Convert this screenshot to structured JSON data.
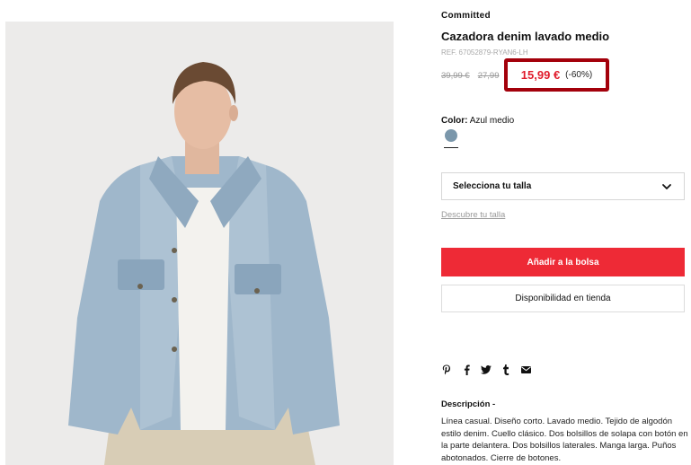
{
  "product": {
    "brand": "Committed",
    "title": "Cazadora denim lavado medio",
    "ref": "REF. 67052879-RYAN6-LH",
    "old_price_1": "39,99 €",
    "old_price_2": "27,99",
    "price": "15,99 €",
    "discount": "(-60%)"
  },
  "color": {
    "label": "Color:",
    "value": "Azul medio",
    "swatch_hex": "#7b97ab"
  },
  "size": {
    "select_label": "Selecciona tu talla",
    "find_link": "Descubre tu talla"
  },
  "actions": {
    "add_to_bag": "Añadir a la bolsa",
    "store_availability": "Disponibilidad en tienda"
  },
  "share_icons": [
    "pinterest-icon",
    "facebook-icon",
    "twitter-icon",
    "tumblr-icon",
    "email-icon"
  ],
  "description": {
    "title": "Descripción -",
    "text": "Línea casual. Diseño corto. Lavado medio. Tejido de algodón estilo denim. Cuello clásico. Dos bolsillos de solapa con botón en la parte delantera. Dos bolsillos laterales. Manga larga. Puños abotonados. Cierre de botones."
  },
  "colors": {
    "accent_red": "#ee2a36",
    "price_red": "#e01c2c",
    "highlight_border": "#a3000b"
  }
}
